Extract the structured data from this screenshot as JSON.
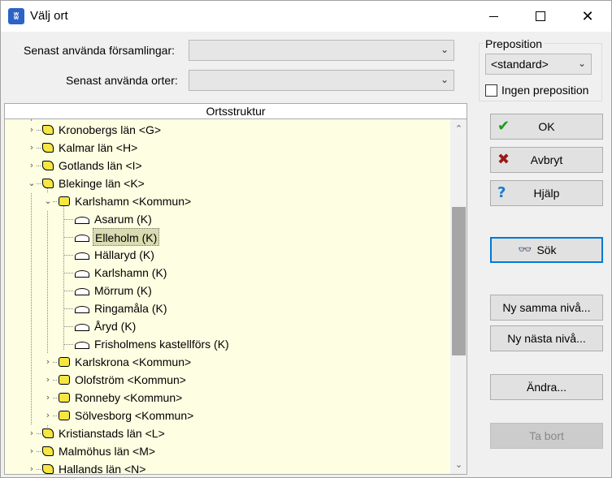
{
  "window": {
    "title": "Välj ort",
    "app_icon_glyph": "ʬ"
  },
  "titlebar": {
    "close_glyph": "✕"
  },
  "recent_parishes": {
    "label": "Senast använda församlingar:",
    "value": ""
  },
  "recent_places": {
    "label": "Senast använda orter:",
    "value": ""
  },
  "preposition": {
    "legend": "Preposition",
    "selected": "<standard>",
    "no_preposition_label": "Ingen preposition",
    "no_preposition_checked": false
  },
  "tree": {
    "header": "Ortsstruktur",
    "rows": [
      {
        "label": "Kronobergs län <G>",
        "type": "lan",
        "expanded": false
      },
      {
        "label": "Kalmar län <H>",
        "type": "lan",
        "expanded": false
      },
      {
        "label": "Gotlands län <I>",
        "type": "lan",
        "expanded": false
      },
      {
        "label": "Blekinge län <K>",
        "type": "lan",
        "expanded": true
      },
      {
        "label": "Karlshamn <Kommun>",
        "type": "kommun",
        "expanded": true
      },
      {
        "label": "Asarum (K)",
        "type": "ort"
      },
      {
        "label": "Elleholm (K)",
        "type": "ort",
        "selected": true
      },
      {
        "label": "Hällaryd (K)",
        "type": "ort"
      },
      {
        "label": "Karlshamn (K)",
        "type": "ort"
      },
      {
        "label": "Mörrum (K)",
        "type": "ort"
      },
      {
        "label": "Ringamåla (K)",
        "type": "ort"
      },
      {
        "label": "Åryd (K)",
        "type": "ort"
      },
      {
        "label": "Frisholmens kastellförs (K)",
        "type": "ort"
      },
      {
        "label": "Karlskrona <Kommun>",
        "type": "kommun",
        "expanded": false
      },
      {
        "label": "Olofström <Kommun>",
        "type": "kommun",
        "expanded": false
      },
      {
        "label": "Ronneby <Kommun>",
        "type": "kommun",
        "expanded": false
      },
      {
        "label": "Sölvesborg <Kommun>",
        "type": "kommun",
        "expanded": false
      },
      {
        "label": "Kristianstads län <L>",
        "type": "lan",
        "expanded": false
      },
      {
        "label": "Malmöhus län <M>",
        "type": "lan",
        "expanded": false
      },
      {
        "label": "Hallands län <N>",
        "type": "lan",
        "expanded": false
      }
    ]
  },
  "buttons": {
    "ok": "OK",
    "cancel": "Avbryt",
    "help": "Hjälp",
    "search": "Sök",
    "new_same_level": "Ny samma nivå...",
    "new_next_level": "Ny nästa nivå...",
    "edit": "Ändra...",
    "delete": "Ta bort"
  },
  "colors": {
    "tree_background": "#fefee2",
    "ok_icon": "#1a9a1a",
    "cancel_icon": "#9a1a1a",
    "help_icon": "#1a7ad0",
    "default_button_border": "#0078d7"
  }
}
